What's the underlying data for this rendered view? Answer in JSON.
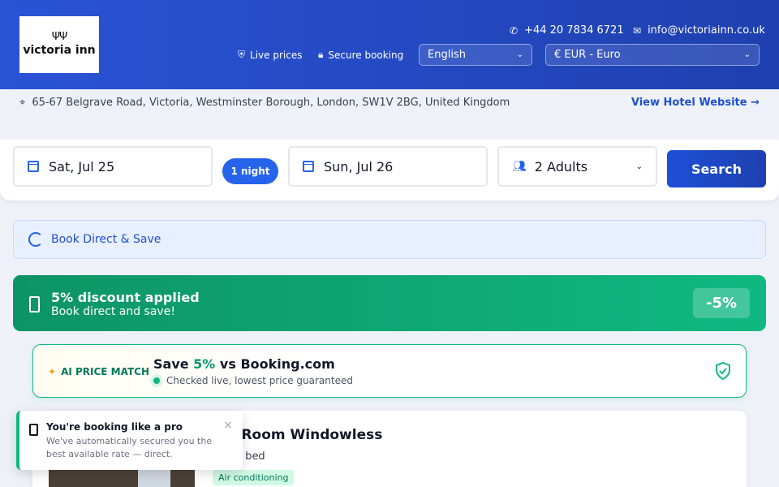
{
  "header": {
    "logo_mark": "&#x2A3A;",
    "logo_text": "victoria inn",
    "phone": "+44 20 7834 6721",
    "email": "info@victoriainn.co.uk",
    "live_prices": "Live prices",
    "secure_booking": "Secure booking",
    "language": "English",
    "currency": "€ EUR - Euro"
  },
  "address": {
    "text": "65-67 Belgrave Road, Victoria, Westminster Borough, London, SW1V 2BG, United Kingdom",
    "view_website": "View Hotel Website →"
  },
  "search": {
    "checkin": "Sat, Jul 25",
    "nights": "1 night",
    "checkout": "Sun, Jul 26",
    "guests": "2 Adults",
    "button": "Search"
  },
  "book_direct": "Book Direct & Save",
  "discount": {
    "title": "5% discount applied",
    "subtitle": "Book direct and save!",
    "badge": "-5%"
  },
  "ai_match": {
    "label": "AI PRICE MATCH",
    "title_prefix": "Save ",
    "title_pct": "5%",
    "title_suffix": " vs Booking.com",
    "subtitle": "Checked live, lowest price guaranteed"
  },
  "room": {
    "title": "ble Room Windowless",
    "bed": "ouble bed",
    "tag": "Air conditioning"
  },
  "toast": {
    "title": "You're booking like a pro",
    "body": "We've automatically secured you the best available rate — direct.",
    "close": "×"
  },
  "colors": {
    "brand": "#1e40af",
    "accent": "#2563eb",
    "success": "#10b981"
  }
}
